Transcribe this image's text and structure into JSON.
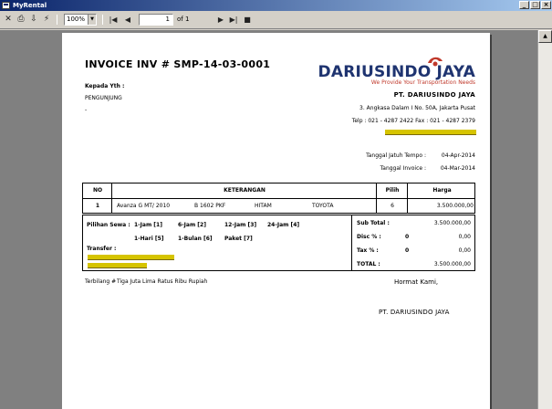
{
  "window": {
    "title": "MyRental"
  },
  "toolbar": {
    "zoom": "100%",
    "page_current": "1",
    "page_of": "of 1"
  },
  "invoice": {
    "title": "INVOICE  INV #  SMP-14-03-0001",
    "to_label": "Kepada Yth :",
    "customer_name": "PENGUNJUNG",
    "customer_extra": "-",
    "company_logo": "DARIUSINDO JAYA",
    "tagline": "We Provide Your Transportation Needs",
    "company_name": "PT. DARIUSINDO JAYA",
    "address": "3. Angkasa Dalam I No. 50A, Jakarta Pusat",
    "phone_fax": "Telp : 021 - 4287 2422       Fax : 021 - 4287 2379",
    "due_date_label": "Tanggal Jatuh Tempo :",
    "due_date": "04-Apr-2014",
    "invoice_date_label": "Tanggal Invoice :",
    "invoice_date": "04-Mar-2014",
    "columns": {
      "no": "NO",
      "keterangan": "KETERANGAN",
      "pilih": "Pilih",
      "harga": "Harga"
    },
    "row": {
      "no": "1",
      "vehicle": "Avanza G MT/ 2010",
      "plate": "B 1602 PKF",
      "color": "HITAM",
      "brand": "TOYOTA",
      "pilih": "6",
      "harga": "3.500.000,00"
    },
    "options_label": "Pilihan Sewa :",
    "options_row1": [
      "1-Jam [1]",
      "6-Jam [2]",
      "12-Jam [3]",
      "24-Jam [4]"
    ],
    "options_row2": [
      "1-Hari [5]",
      "1-Bulan [6]",
      "Paket [7]"
    ],
    "transfer_label": "Transfer :",
    "subtotal_label": "Sub Total :",
    "subtotal": "3.500.000,00",
    "disc_label": "Disc % :",
    "disc_pct": "0",
    "disc_amount": "0,00",
    "tax_label": "Tax % :",
    "tax_pct": "0",
    "tax_amount": "0,00",
    "total_label": "TOTAL :",
    "total": "3.500.000,00",
    "terbilang_label": "Terbilang #",
    "terbilang": "Tiga Juta Lima Ratus Ribu Rupiah",
    "closing": "Hormat Kami,",
    "signatory": "PT. DARIUSINDO JAYA"
  },
  "colors": {
    "brand_navy": "#1f3470",
    "brand_red": "#c0392b",
    "redaction": "#d6c400"
  }
}
